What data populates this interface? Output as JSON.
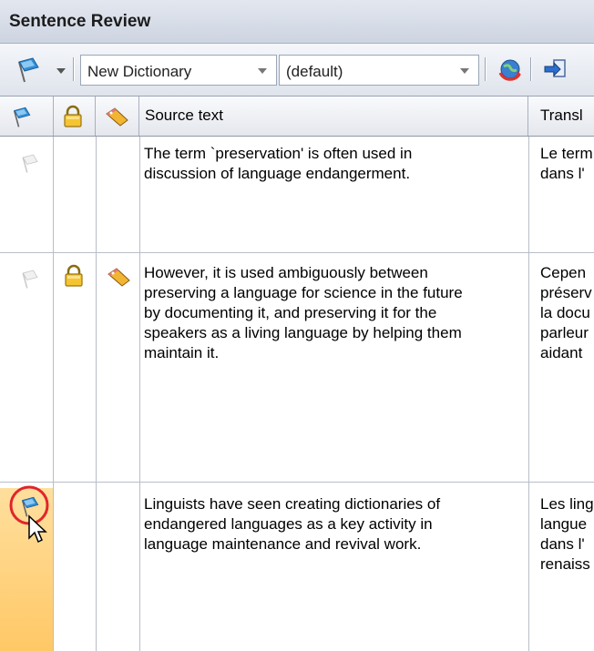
{
  "panel": {
    "title": "Sentence Review"
  },
  "toolbar": {
    "dictionary_select": "New Dictionary",
    "profile_select": "(default)"
  },
  "grid": {
    "columns": {
      "source": "Source text",
      "translation": "Transl"
    },
    "rows": [
      {
        "source_lines": [
          "The term `preservation' is often used in",
          "discussion of language endangerment."
        ],
        "translation_lines": [
          "Le term",
          "dans l'"
        ]
      },
      {
        "source_lines": [
          "However, it is used ambiguously between",
          "preserving a language for science in the future",
          "by documenting it, and preserving it for the",
          "speakers as a living language by helping them",
          "maintain it."
        ],
        "translation_lines": [
          "Cepen",
          "préserv",
          "la docu",
          "parleur",
          "aidant"
        ]
      },
      {
        "source_lines": [
          "Linguists have seen creating dictionaries of",
          "endangered languages as a key activity in",
          "language maintenance and revival work."
        ],
        "translation_lines": [
          "Les ling",
          "langue",
          "dans l'",
          "renaiss"
        ]
      }
    ]
  },
  "colors": {
    "flag_active": "#2f8fd8",
    "selection": "#ffcf74",
    "highlight_ring": "#e0262b"
  }
}
